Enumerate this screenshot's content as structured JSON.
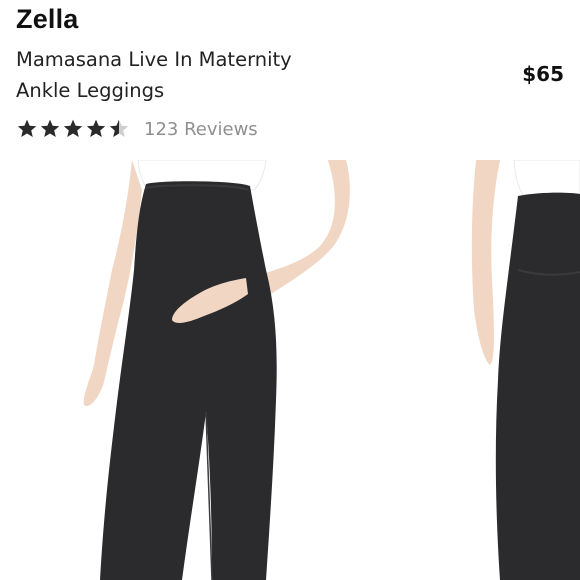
{
  "product": {
    "brand": "Zella",
    "title_line1": "Mamasana Live In Maternity",
    "title_line2": "Ankle Leggings",
    "price": "$65"
  },
  "rating": {
    "value": 4.5,
    "out_of": 5,
    "reviews_label": "123 Reviews",
    "star_color": "#2a2a2a",
    "empty_star_color": "#cfcfcf"
  },
  "colors": {
    "legging": "#2b2b2d",
    "skin": "#f2d6c4",
    "top": "#ffffff"
  },
  "gallery": {
    "images": [
      "front-view-photo",
      "side-view-photo"
    ]
  }
}
